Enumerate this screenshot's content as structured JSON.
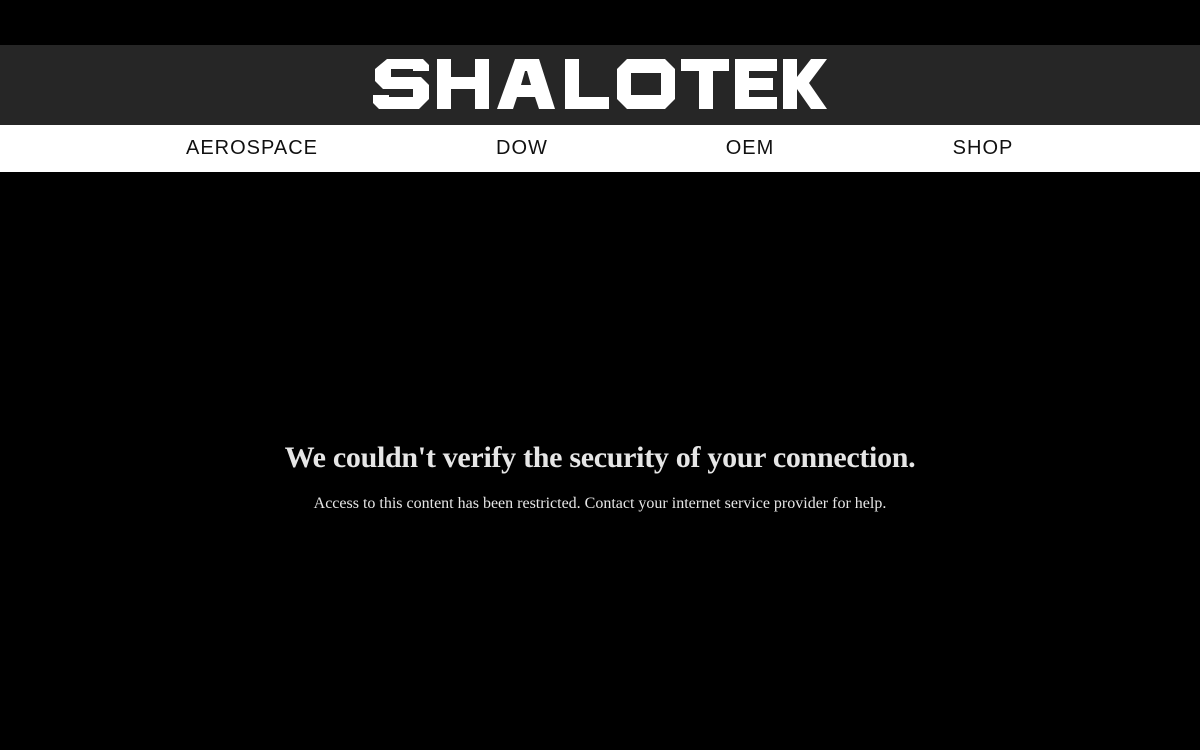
{
  "brand": {
    "name": "SHALOTEK",
    "logo_color": "#ffffff",
    "bar_color": "#262626"
  },
  "nav": {
    "items": [
      {
        "label": "AEROSPACE"
      },
      {
        "label": "DOW"
      },
      {
        "label": "OEM"
      },
      {
        "label": "SHOP"
      }
    ]
  },
  "error": {
    "title": "We couldn't verify the security of your connection.",
    "message": "Access to this content has been restricted. Contact your internet service provider for help."
  },
  "colors": {
    "page_background": "#000000",
    "nav_background": "#ffffff",
    "nav_text": "#111111",
    "message_text": "#e6e6e6"
  }
}
